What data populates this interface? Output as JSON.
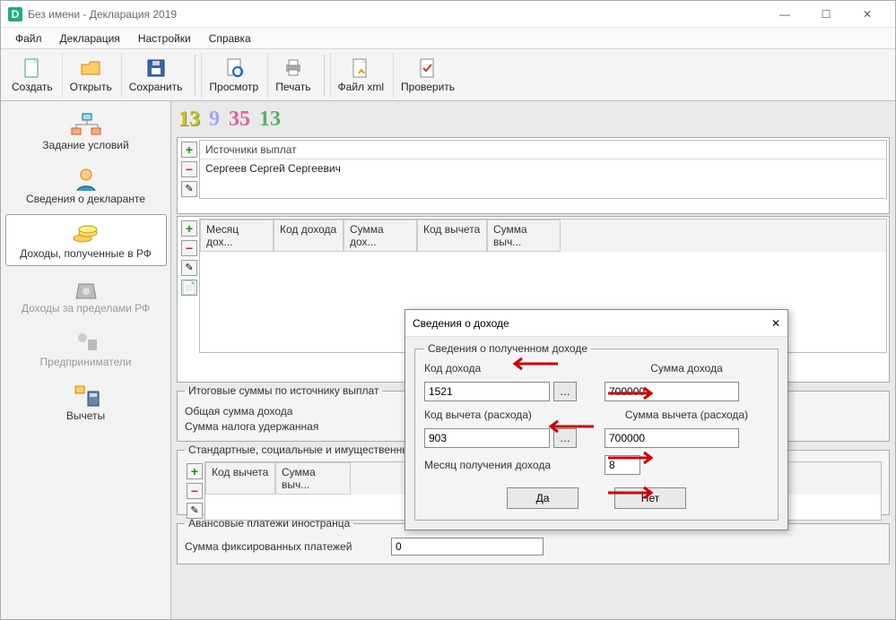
{
  "window": {
    "title": "Без имени - Декларация 2019"
  },
  "menu": {
    "file": "Файл",
    "declaration": "Декларация",
    "settings": "Настройки",
    "help": "Справка"
  },
  "toolbar": {
    "create": "Создать",
    "open": "Открыть",
    "save": "Сохранить",
    "preview": "Просмотр",
    "print": "Печать",
    "xml": "Файл xml",
    "check": "Проверить"
  },
  "sidebar": {
    "cond": "Задание условий",
    "decl": "Сведения о декларанте",
    "rf": "Доходы, полученные в РФ",
    "abroad": "Доходы за пределами РФ",
    "ent": "Предприниматели",
    "ded": "Вычеты"
  },
  "tax_rates": {
    "r1": "13",
    "r2": "9",
    "r3": "35",
    "r4": "13"
  },
  "sources": {
    "header": "Источники выплат",
    "row1": "Сергеев Сергей Сергеевич"
  },
  "income_grid": {
    "c1": "Месяц дох...",
    "c2": "Код дохода",
    "c3": "Сумма дох...",
    "c4": "Код вычета",
    "c5": "Сумма выч..."
  },
  "totals": {
    "legend": "Итоговые суммы по источнику выплат",
    "l1": "Общая сумма дохода",
    "l2": "Сумма налога удержанная"
  },
  "std": {
    "legend": "Стандартные, социальные и имущественные вычеты",
    "c1": "Код вычета",
    "c2": "Сумма выч..."
  },
  "advance": {
    "legend": "Авансовые платежи иностранца",
    "label": "Сумма фиксированных платежей",
    "value": "0"
  },
  "dialog": {
    "title": "Сведения о доходе",
    "legend": "Сведения о полученном доходе",
    "l_code": "Код дохода",
    "l_sum": "Сумма дохода",
    "v_code": "1521",
    "v_sum": "700000",
    "l_dcode": "Код вычета (расхода)",
    "l_dsum": "Сумма вычета (расхода)",
    "v_dcode": "903",
    "v_dsum": "700000",
    "l_month": "Месяц получения дохода",
    "v_month": "8",
    "ok": "Да",
    "cancel": "Нет"
  }
}
